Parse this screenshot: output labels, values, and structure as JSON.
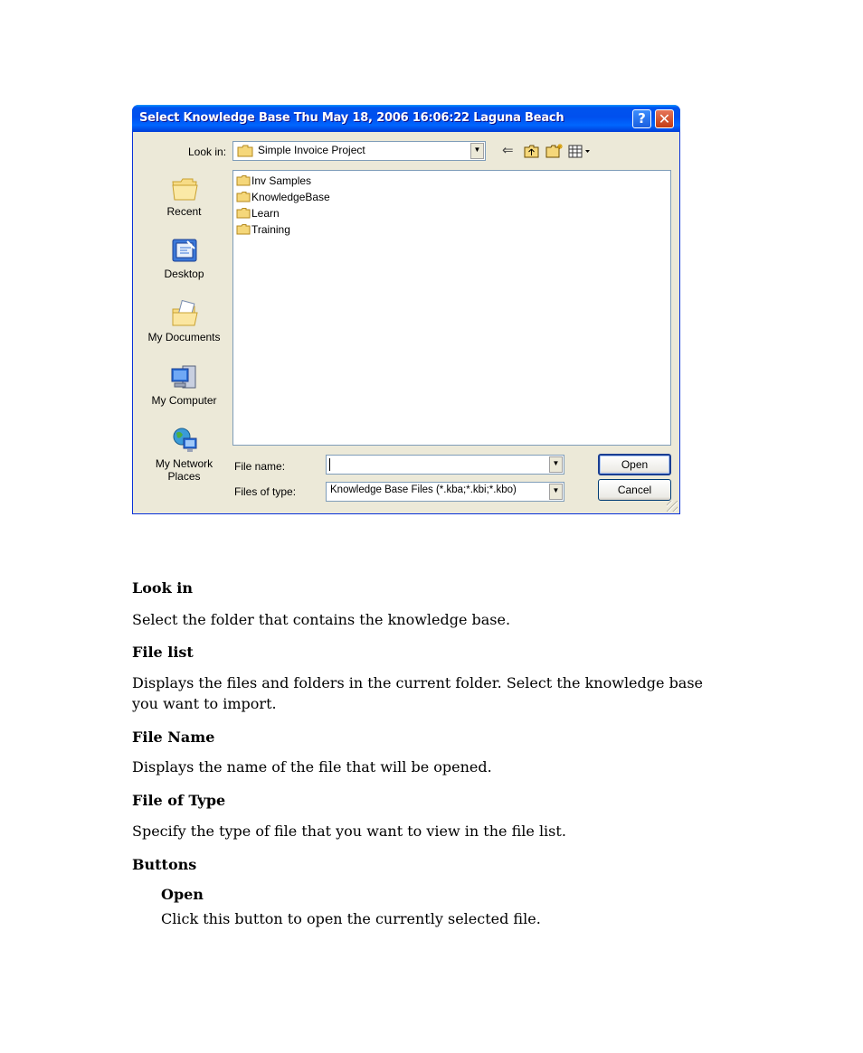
{
  "dialog": {
    "title": "Select Knowledge Base   Thu May 18, 2006 16:06:22 Laguna Beach",
    "help_glyph": "?",
    "close_glyph": "✕",
    "look_in_label": "Look in:",
    "look_in_value": "Simple Invoice Project",
    "places": [
      {
        "label": "Recent",
        "icon": "recent-folder-icon"
      },
      {
        "label": "Desktop",
        "icon": "desktop-icon"
      },
      {
        "label": "My Documents",
        "icon": "my-documents-icon"
      },
      {
        "label": "My Computer",
        "icon": "my-computer-icon"
      },
      {
        "label": "My Network Places",
        "icon": "network-places-icon"
      }
    ],
    "files": [
      "Inv Samples",
      "KnowledgeBase",
      "Learn",
      "Training"
    ],
    "file_name_label": "File name:",
    "file_name_value": "",
    "file_type_label": "Files of type:",
    "file_type_value": "Knowledge Base Files (*.kba;*.kbi;*.kbo)",
    "open_button": "Open",
    "cancel_button": "Cancel",
    "colors": {
      "title_bar": "#0054e3",
      "dialog_bg": "#ece9d8",
      "list_border": "#7f9db9"
    }
  },
  "doc": {
    "sections": [
      {
        "heading": "Look in",
        "body": "Select the folder that contains the knowledge base."
      },
      {
        "heading": "File list",
        "body": "Displays the files and folders in the current folder. Select the knowledge base you want to import."
      },
      {
        "heading": "File Name",
        "body": "Displays the name of the file that will be opened."
      },
      {
        "heading": "File of Type",
        "body": "Specify the type of file that you want to view in the file list."
      },
      {
        "heading": "Buttons",
        "body": ""
      }
    ],
    "sub": {
      "heading": "Open",
      "body": "Click this button to open the currently selected file."
    }
  }
}
